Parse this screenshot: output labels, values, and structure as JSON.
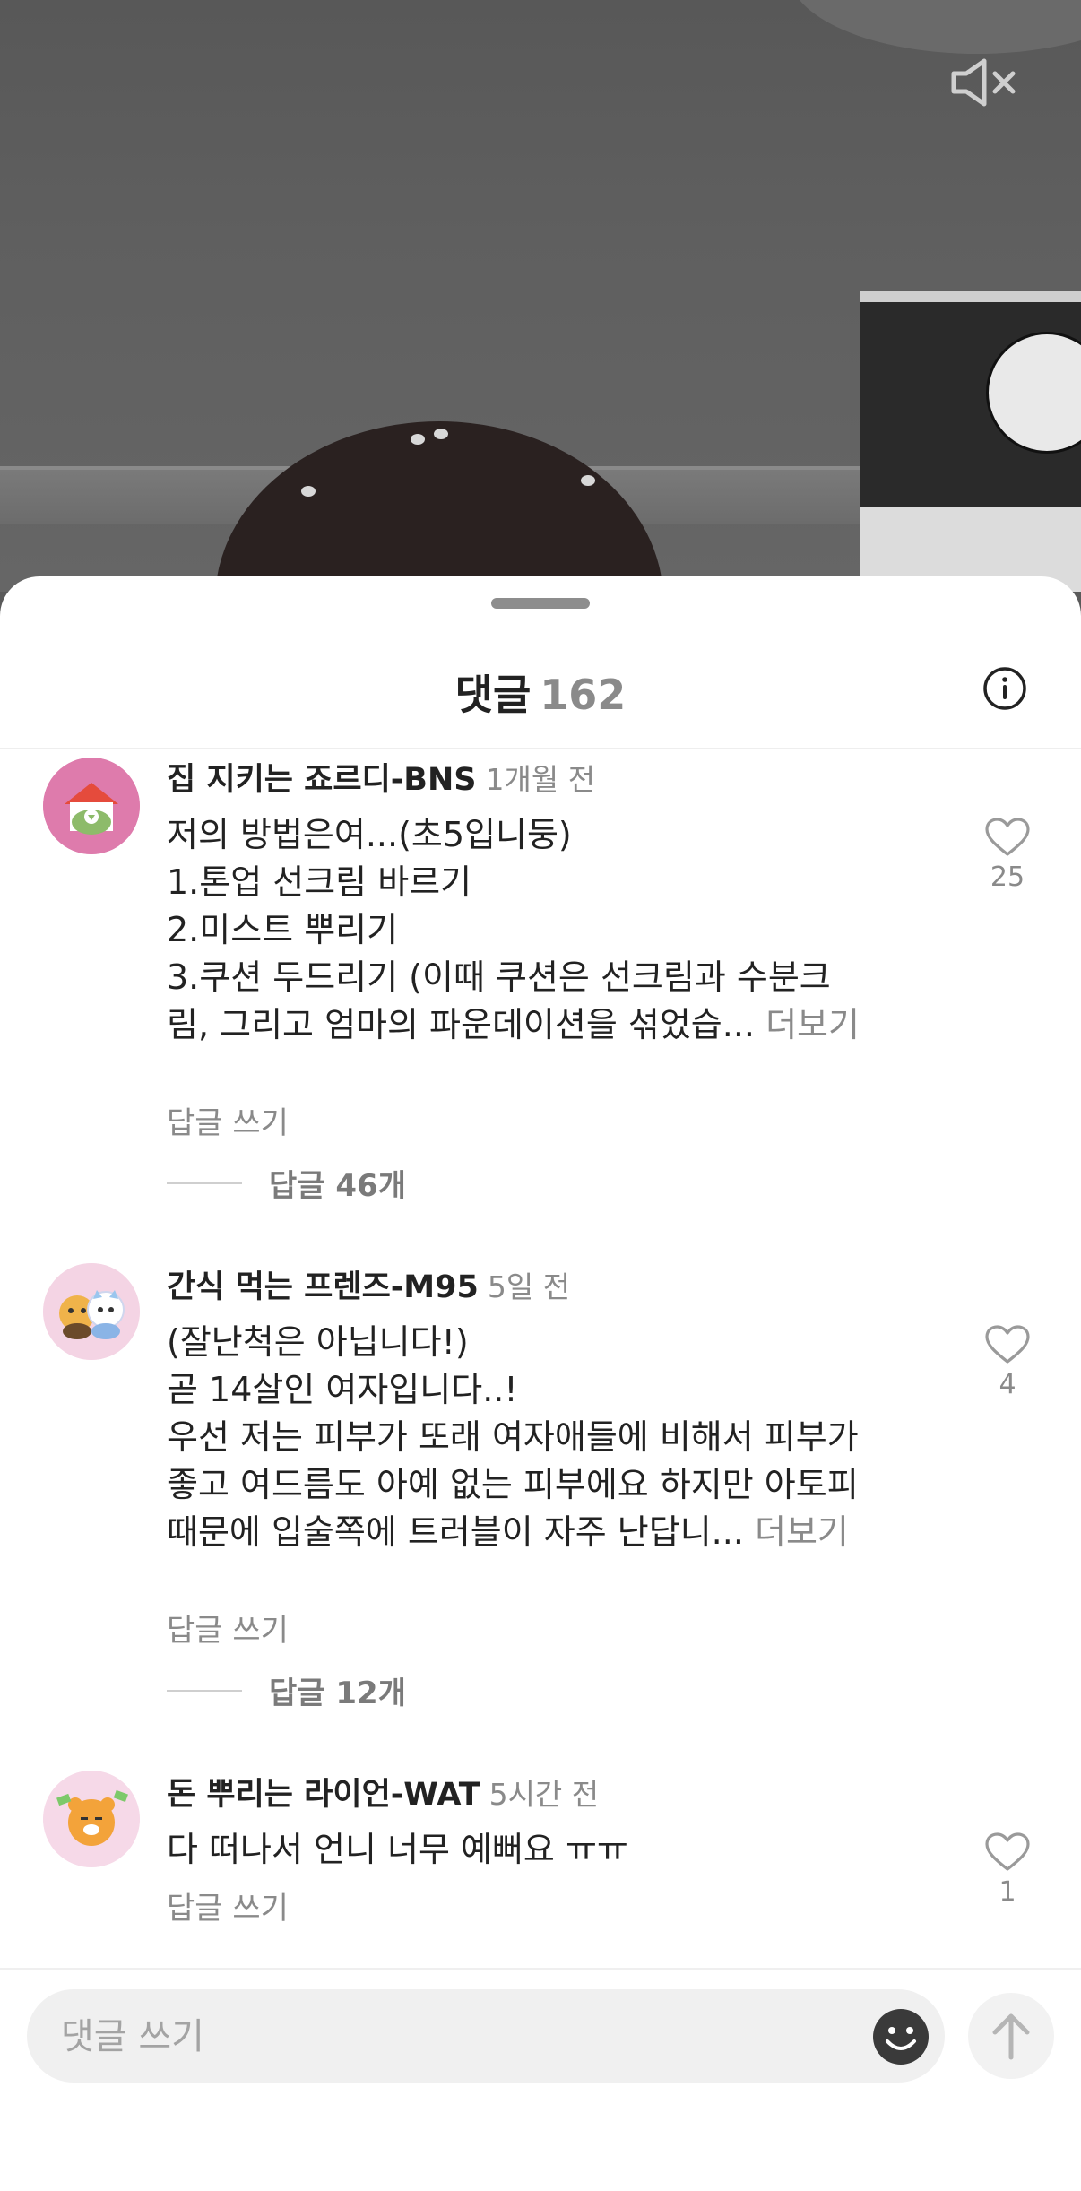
{
  "sheet": {
    "title": "댓글",
    "count": "162"
  },
  "comments": [
    {
      "author": "집 지키는 죠르디-BNS",
      "time": "1개월 전",
      "lines": [
        "저의 방법은여...(초5입니둥)",
        "1.톤업 선크림 바르기",
        "2.미스트 뿌리기",
        "3.쿠션 두드리기 (이때 쿠션은 선크림과 수분크",
        "림, 그리고 엄마의 파운데이션을 섞었습..."
      ],
      "more": "더보기",
      "reply_write": "답글 쓰기",
      "replies": "답글 46개",
      "likes": "25"
    },
    {
      "author": "간식 먹는 프렌즈-M95",
      "time": "5일 전",
      "lines": [
        "(잘난척은 아닙니다!)",
        "곧 14살인 여자입니다..!",
        "우선 저는 피부가 또래 여자애들에 비해서 피부가",
        "좋고 여드름도 아예 없는 피부에요 하지만 아토피",
        "때문에 입술쪽에 트러블이 자주 난답니..."
      ],
      "more": "더보기",
      "reply_write": "답글 쓰기",
      "replies": "답글 12개",
      "likes": "4"
    },
    {
      "author": "돈 뿌리는 라이언-WAT",
      "time": "5시간 전",
      "lines": [
        "다 떠나서 언니 너무 예뻐요 ㅠㅠ"
      ],
      "reply_write": "답글 쓰기",
      "likes": "1"
    }
  ],
  "input": {
    "placeholder": "댓글 쓰기"
  },
  "icons": {
    "mute": "speaker-muted-icon",
    "info": "info-icon",
    "like": "heart-outline-icon",
    "emoji": "smiley-icon",
    "send": "arrow-up-icon"
  }
}
